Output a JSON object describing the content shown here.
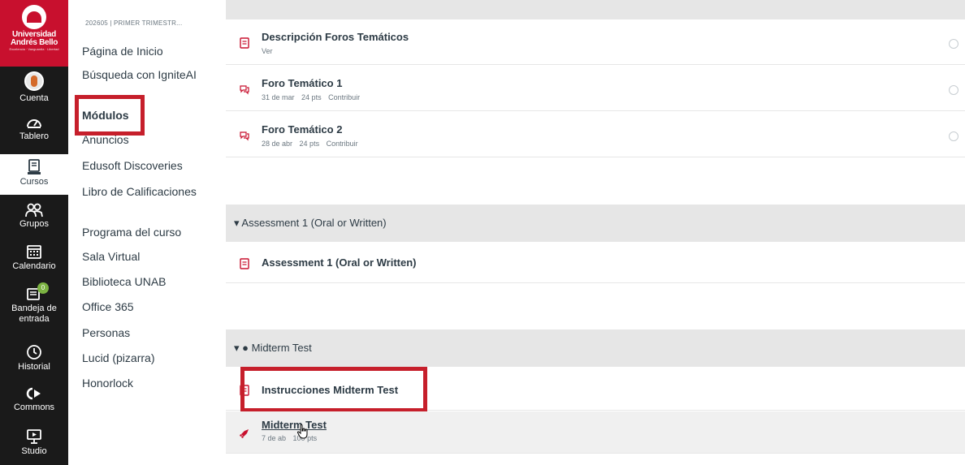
{
  "brand": {
    "logo_text_line1": "Universidad",
    "logo_text_line2": "Andrés Bello",
    "logo_tagline": "Excelencia · Vanguardia · Libertad",
    "color": "#c8102e"
  },
  "global_nav": {
    "items": [
      {
        "label": "Cuenta",
        "icon": "account-avatar-icon"
      },
      {
        "label": "Tablero",
        "icon": "dashboard-icon"
      },
      {
        "label": "Cursos",
        "icon": "courses-icon",
        "active": true
      },
      {
        "label": "Grupos",
        "icon": "groups-icon"
      },
      {
        "label": "Calendario",
        "icon": "calendar-icon"
      },
      {
        "label": "Bandeja de entrada",
        "icon": "inbox-icon",
        "badge": "0"
      },
      {
        "label": "Historial",
        "icon": "history-icon"
      },
      {
        "label": "Commons",
        "icon": "commons-icon"
      },
      {
        "label": "Studio",
        "icon": "studio-icon"
      }
    ]
  },
  "course_nav": {
    "term": "202605 | PRIMER TRIMESTR...",
    "items": [
      {
        "label": "Página de Inicio"
      },
      {
        "label": "Búsqueda con IgniteAI"
      },
      {
        "label": "Módulos",
        "active": true
      },
      {
        "label": "Anuncios"
      },
      {
        "label": "Edusoft Discoveries"
      },
      {
        "label": "Libro de Calificaciones"
      },
      {
        "label": "Programa del curso"
      },
      {
        "label": "Sala Virtual"
      },
      {
        "label": "Biblioteca UNAB"
      },
      {
        "label": "Office 365"
      },
      {
        "label": "Personas"
      },
      {
        "label": "Lucid (pizarra)"
      },
      {
        "label": "Honorlock"
      }
    ]
  },
  "modules": {
    "forums": [
      {
        "title": "Descripción Foros Temáticos",
        "meta": [
          "Ver"
        ],
        "icon": "page-icon"
      },
      {
        "title": "Foro Temático 1",
        "meta": [
          "31 de mar",
          "24 pts",
          "Contribuir"
        ],
        "icon": "discussion-icon"
      },
      {
        "title": "Foro Temático 2",
        "meta": [
          "28 de abr",
          "24 pts",
          "Contribuir"
        ],
        "icon": "discussion-icon"
      }
    ],
    "assessment": {
      "header": "▾ Assessment 1 (Oral or Written)",
      "items": [
        {
          "title": "Assessment 1 (Oral or Written)",
          "icon": "page-icon"
        }
      ]
    },
    "midterm": {
      "header": "▾ ● Midterm Test",
      "items": [
        {
          "title": "Instrucciones Midterm Test",
          "icon": "page-icon"
        },
        {
          "title": "Midterm Test",
          "meta": [
            "7 de ab",
            "100 pts"
          ],
          "icon": "quiz-rocket-icon"
        }
      ]
    }
  },
  "colors": {
    "highlight_box": "#c61f2b",
    "nav_bg": "#1a1a1a",
    "accent_red": "#c8102e"
  }
}
